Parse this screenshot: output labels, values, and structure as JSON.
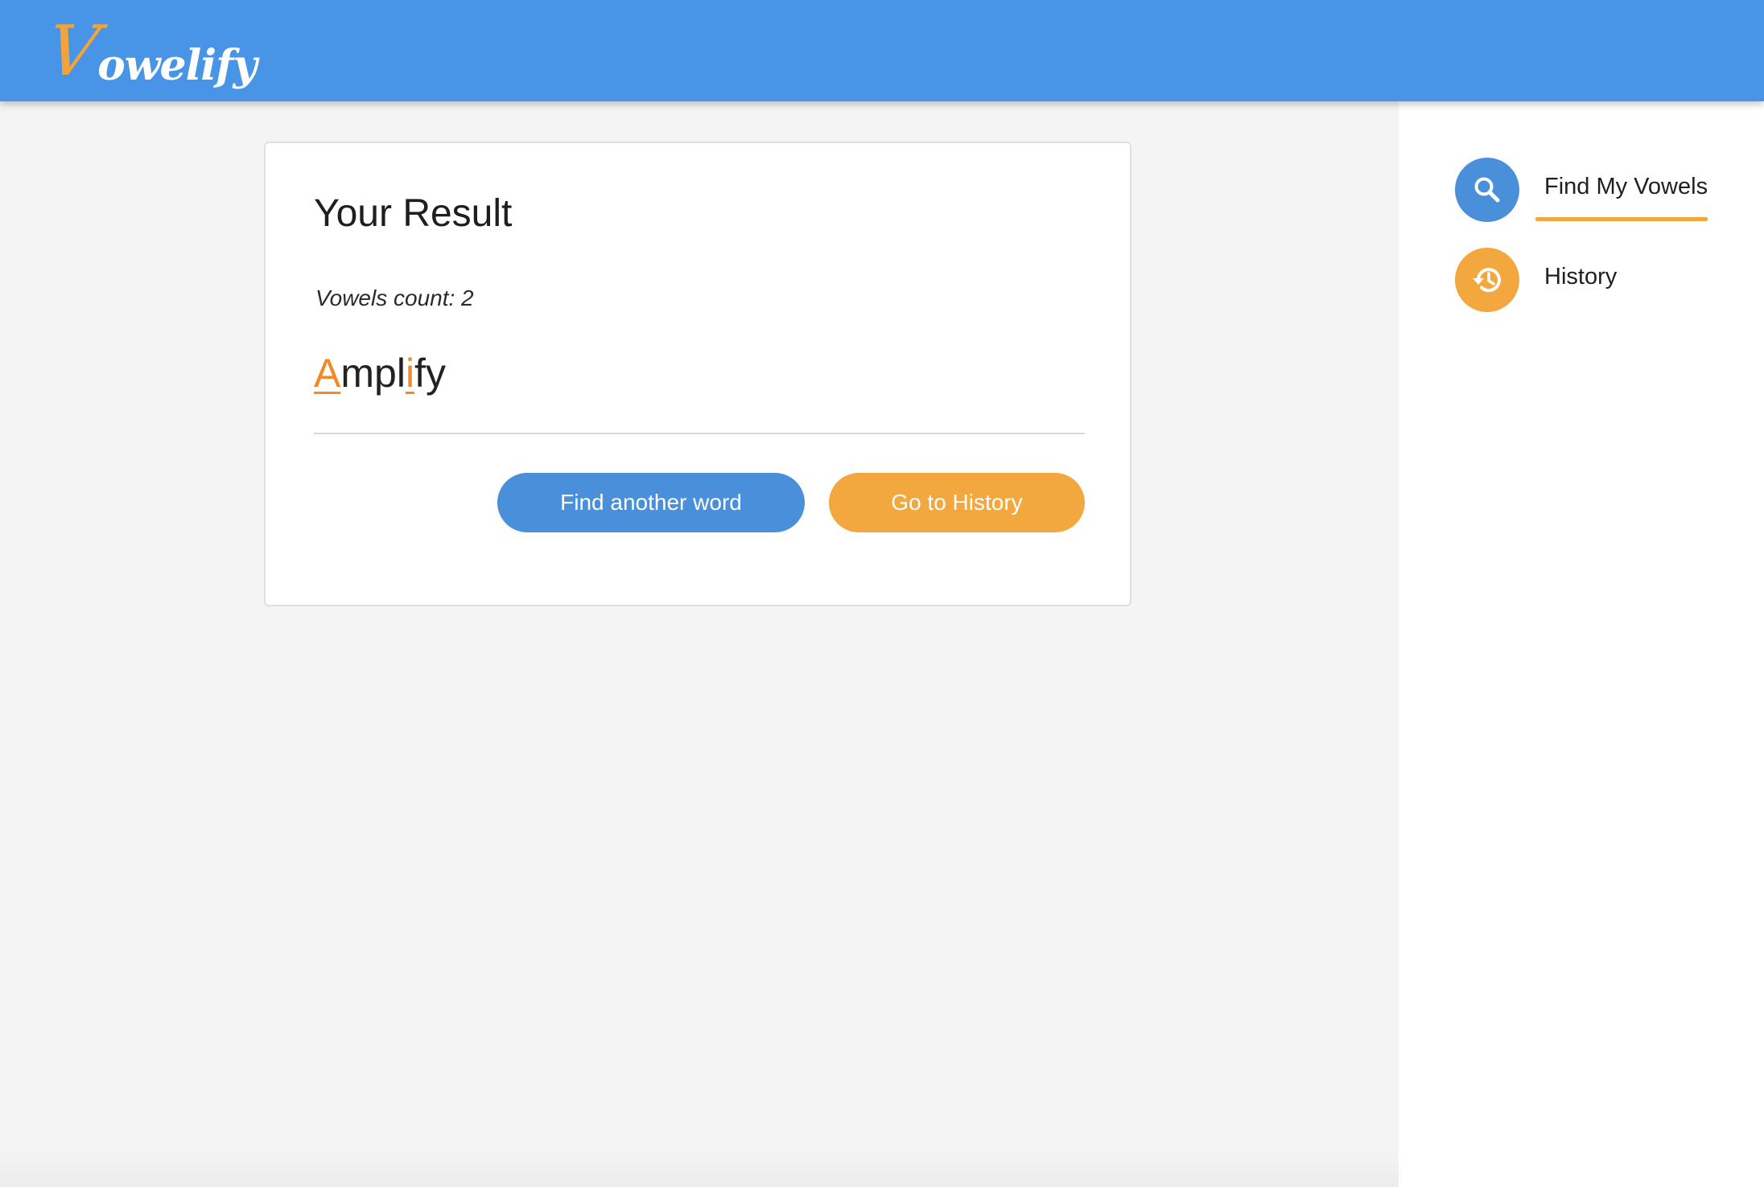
{
  "header": {
    "logo_initial": "V",
    "logo_rest": "owelify"
  },
  "sidebar": {
    "items": [
      {
        "label": "Find My Vowels",
        "icon": "search-icon",
        "active": true
      },
      {
        "label": "History",
        "icon": "history-icon",
        "active": false
      }
    ]
  },
  "result": {
    "title": "Your Result",
    "vowels_count": "Vowels count: 2",
    "word_parts": [
      "A",
      "mpl",
      "i",
      "fy"
    ],
    "buttons": {
      "find_another": "Find another word",
      "go_history": "Go to History"
    }
  },
  "colors": {
    "header": "#4895e8",
    "primary_blue": "#4a8fd9",
    "accent_orange": "#f2a83e",
    "vowel_highlight": "#f08a2a",
    "background": "#f4f4f4"
  }
}
